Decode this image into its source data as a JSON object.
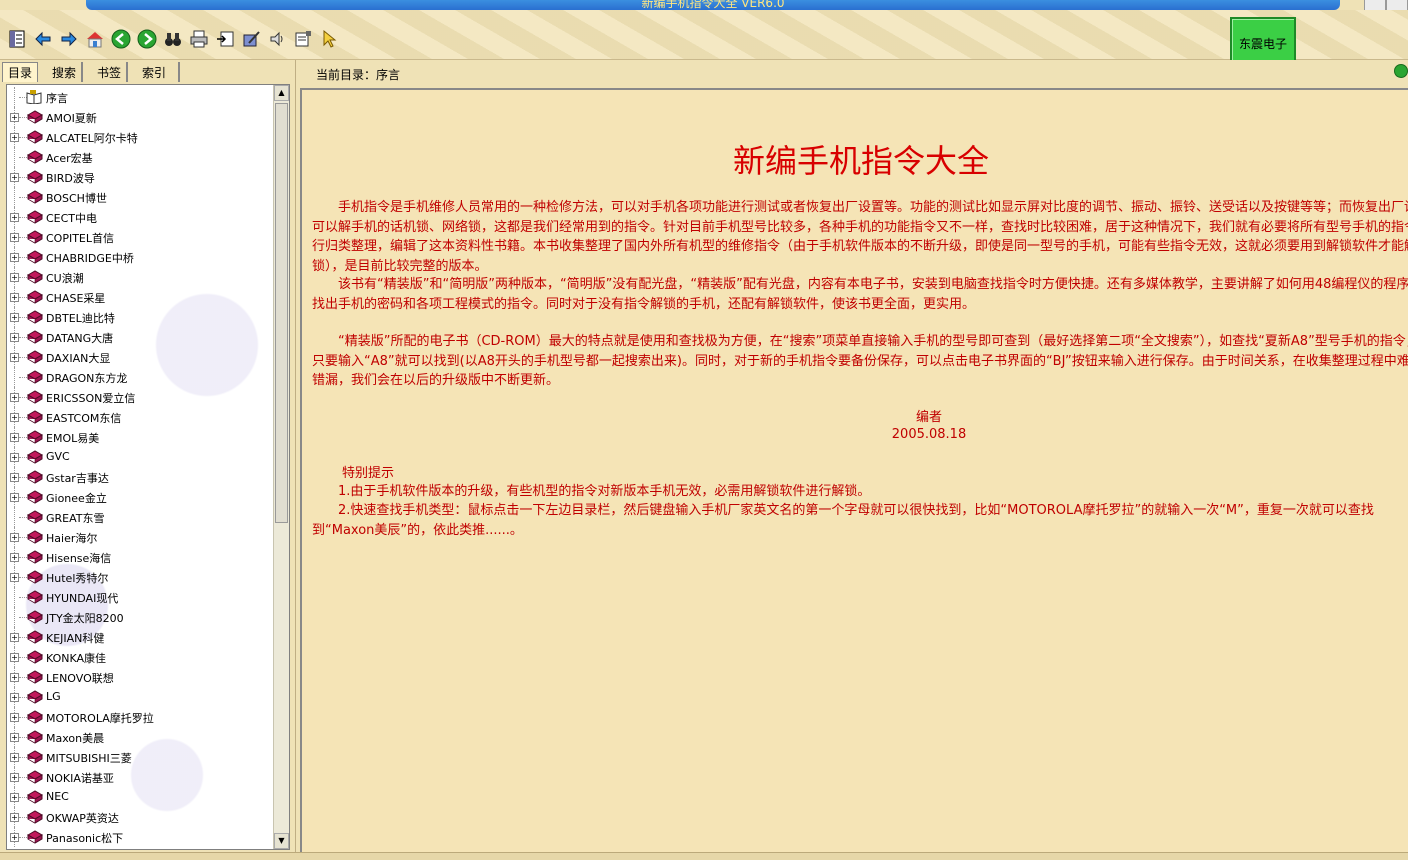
{
  "window": {
    "title": "新编手机指令大全 VER6.0"
  },
  "toolbar": {
    "tools": [
      {
        "icon": "toc-icon"
      },
      {
        "icon": "back-arrow-icon"
      },
      {
        "icon": "forward-arrow-icon"
      },
      {
        "icon": "home-icon"
      },
      {
        "icon": "green-back-icon"
      },
      {
        "icon": "green-forward-icon"
      },
      {
        "icon": "binoculars-icon"
      },
      {
        "icon": "printer-icon"
      },
      {
        "icon": "export-icon"
      },
      {
        "icon": "bookmark-pen-icon"
      },
      {
        "icon": "speaker-icon"
      },
      {
        "icon": "options-icon"
      },
      {
        "icon": "pointer-icon"
      }
    ],
    "brand_button": "东震电子"
  },
  "sidebar": {
    "tabs": [
      "目录",
      "搜索",
      "书签",
      "索引"
    ],
    "active_tab": "目录",
    "tree": [
      {
        "label": "序言",
        "expandable": false,
        "icon": "open-book-icon"
      },
      {
        "label": "AMOI夏新",
        "expandable": true
      },
      {
        "label": "ALCATEL阿尔卡特",
        "expandable": true
      },
      {
        "label": "Acer宏基",
        "expandable": false
      },
      {
        "label": "BIRD波导",
        "expandable": true
      },
      {
        "label": "BOSCH博世",
        "expandable": false
      },
      {
        "label": "CECT中电",
        "expandable": true
      },
      {
        "label": "COPITEL首信",
        "expandable": true
      },
      {
        "label": "CHABRIDGE中桥",
        "expandable": true
      },
      {
        "label": "CU浪潮",
        "expandable": true
      },
      {
        "label": "CHASE采星",
        "expandable": true
      },
      {
        "label": "DBTEL迪比特",
        "expandable": true
      },
      {
        "label": "DATANG大唐",
        "expandable": true
      },
      {
        "label": "DAXIAN大显",
        "expandable": true
      },
      {
        "label": "DRAGON东方龙",
        "expandable": false
      },
      {
        "label": "ERICSSON爱立信",
        "expandable": true
      },
      {
        "label": "EASTCOM东信",
        "expandable": true
      },
      {
        "label": "EMOL易美",
        "expandable": true
      },
      {
        "label": "GVC",
        "expandable": true
      },
      {
        "label": "Gstar吉事达",
        "expandable": true
      },
      {
        "label": "Gionee金立",
        "expandable": true
      },
      {
        "label": "GREAT东雪",
        "expandable": false
      },
      {
        "label": "Haier海尔",
        "expandable": true
      },
      {
        "label": "Hisense海信",
        "expandable": true
      },
      {
        "label": "Hutel秀特尔",
        "expandable": true
      },
      {
        "label": "HYUNDAI现代",
        "expandable": false
      },
      {
        "label": "JTY金太阳8200",
        "expandable": false
      },
      {
        "label": "KEJIAN科健",
        "expandable": true
      },
      {
        "label": "KONKA康佳",
        "expandable": true
      },
      {
        "label": "LENOVO联想",
        "expandable": true
      },
      {
        "label": "LG",
        "expandable": true
      },
      {
        "label": "MOTOROLA摩托罗拉",
        "expandable": true
      },
      {
        "label": "Maxon美晨",
        "expandable": true
      },
      {
        "label": "MITSUBISHI三菱",
        "expandable": true
      },
      {
        "label": "NOKIA诺基亚",
        "expandable": true
      },
      {
        "label": "NEC",
        "expandable": true
      },
      {
        "label": "OKWAP英资达",
        "expandable": true
      },
      {
        "label": "Panasonic松下",
        "expandable": true
      }
    ]
  },
  "main": {
    "breadcrumb": "当前目录：序言",
    "title": "新编手机指令大全",
    "paragraphs": [
      "手机指令是手机维修人员常用的一种检修方法，可以对手机各项功能进行测试或者恢复出厂设置等。功能的测试比如显示屏对比度的调节、振动、振铃、送受话以及按键等等；而恢复出厂设置可以解手机的话机锁、网络锁，这都是我们经常用到的指令。针对目前手机型号比较多，各种手机的功能指令又不一样，查找时比较困难，居于这种情况下，我们就有必要将所有型号手机的指令进行归类整理，编辑了这本资料性书籍。本书收集整理了国内外所有机型的维修指令（由于手机软件版本的不断升级，即使是同一型号的手机，可能有些指令无效，这就必须要用到解锁软件才能解锁），是目前比较完整的版本。",
      "该书有“精装版”和“简明版”两种版本，“简明版”没有配光盘，“精装版”配有光盘，内容有本电子书，安装到电脑查找指令时方便快捷。还有多媒体教学，主要讲解了如何用48编程仪的程序来找出手机的密码和各项工程模式的指令。同时对于没有指令解锁的手机，还配有解锁软件，使该书更全面，更实用。",
      "“精装版”所配的电子书（CD-ROM）最大的特点就是使用和查找极为方便，在“搜索”项菜单直接输入手机的型号即可查到（最好选择第二项“全文搜索”），如查找“夏新A8”型号手机的指令，就只要输入“A8”就可以找到(以A8开头的手机型号都一起搜索出来)。同时，对于新的手机指令要备份保存，可以点击电子书界面的“BJ”按钮来输入进行保存。由于时间关系，在收集整理过程中难免错漏，我们会在以后的升级版中不断更新。"
    ],
    "author": "编者",
    "date": "2005.08.18",
    "tips_title": "特别提示",
    "tips": [
      "1.由于手机软件版本的升级，有些机型的指令对新版本手机无效，必需用解锁软件进行解锁。",
      "2.快速查找手机类型：鼠标点击一下左边目录栏，然后键盘输入手机厂家英文名的第一个字母就可以很快找到，比如“MOTOROLA摩托罗拉”的就输入一次“M”，重复一次就可以查找到“Maxon美辰”的，依此类推......。"
    ]
  },
  "colors": {
    "text_red": "#c00000",
    "background": "#f5e4b6",
    "brand_green": "#3bcf45"
  }
}
